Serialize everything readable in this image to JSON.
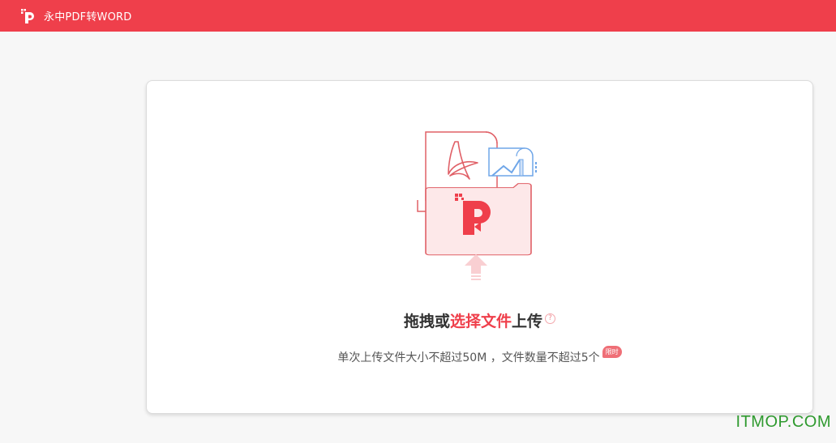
{
  "header": {
    "app_title": "永中PDF转WORD",
    "logo_icon": "yozo-pdf-logo-icon"
  },
  "upload": {
    "headline_before": "拖拽或",
    "headline_link": "选择文件",
    "headline_after": "上传",
    "help_glyph": "?",
    "subtext": "单次上传文件大小不超过50M ，文件数量不超过5个",
    "badge": "限时"
  },
  "watermark": "ITMOP.COM",
  "colors": {
    "brand_red": "#ef3f4b",
    "page_bg": "#f7f7f7",
    "card_bg": "#ffffff",
    "watermark_green": "#2f9a2f"
  }
}
